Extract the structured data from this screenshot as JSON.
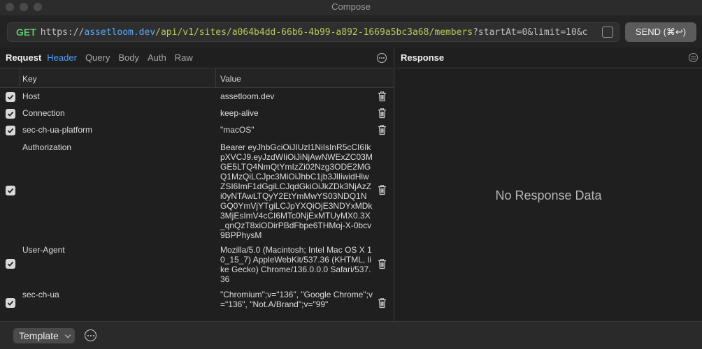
{
  "window": {
    "title": "Compose"
  },
  "request_bar": {
    "method": "GET",
    "url_scheme": "https://",
    "url_host": "assetloom.dev",
    "url_path": "/api/v1/sites/a064b4dd-66b6-4b99-a892-1669a5bc3a68/members",
    "url_query": "?startAt=0&limit=10&c",
    "send_label": "SEND (⌘↩)"
  },
  "request_panel": {
    "title": "Request",
    "tabs": [
      {
        "label": "Header",
        "active": true
      },
      {
        "label": "Query",
        "active": false
      },
      {
        "label": "Body",
        "active": false
      },
      {
        "label": "Auth",
        "active": false
      },
      {
        "label": "Raw",
        "active": false
      }
    ],
    "columns": {
      "key": "Key",
      "value": "Value"
    },
    "headers": [
      {
        "key": "Host",
        "value": "assetloom.dev",
        "checked": true
      },
      {
        "key": "Connection",
        "value": "keep-alive",
        "checked": true
      },
      {
        "key": "sec-ch-ua-platform",
        "value": "\"macOS\"",
        "checked": true
      },
      {
        "key": "Authorization",
        "value": "Bearer eyJhbGciOiJIUzI1NiIsInR5cCI6IkpXVCJ9.eyJzdWIiOiJiNjAwNWExZC03MGE5LTQ4NmQtYmIzZi02Nzg3ODE2MGQ1MzQiLCJpc3MiOiJhbC1jb3JlIiwidHlwZSI6ImF1dGgiLCJqdGkiOiJkZDk3NjAzZi0yNTAwLTQyY2EtYmMwYS03NDQ1NGQ0YmVjYTgiLCJpYXQiOjE3NDYxMDk3MjEsImV4cCI6MTc0NjExMTUyMX0.3X_qnQzT8xiODirPBdFbpe6THMoj-X-0bcv9BPPhysM",
        "checked": true
      },
      {
        "key": "User-Agent",
        "value": "Mozilla/5.0 (Macintosh; Intel Mac OS X 10_15_7) AppleWebKit/537.36 (KHTML, like Gecko) Chrome/136.0.0.0 Safari/537.36",
        "checked": true
      },
      {
        "key": "sec-ch-ua",
        "value": "\"Chromium\";v=\"136\", \"Google Chrome\";v=\"136\", \"Not.A/Brand\";v=\"99\"",
        "checked": true
      }
    ]
  },
  "response_panel": {
    "title": "Response",
    "empty_text": "No Response Data"
  },
  "bottom_bar": {
    "template_label": "Template"
  },
  "icons": {
    "more": "ellipsis-circle-icon",
    "filter": "filter-lines-icon",
    "trash": "trash-icon",
    "check": "checkmark-icon",
    "expand": "expand-url-icon",
    "chevron": "chevron-down-icon"
  },
  "colors": {
    "method": "#5ec46a",
    "url_host": "#5aa9ff",
    "url_path": "#b9c95a",
    "active_tab": "#4f9dff"
  }
}
